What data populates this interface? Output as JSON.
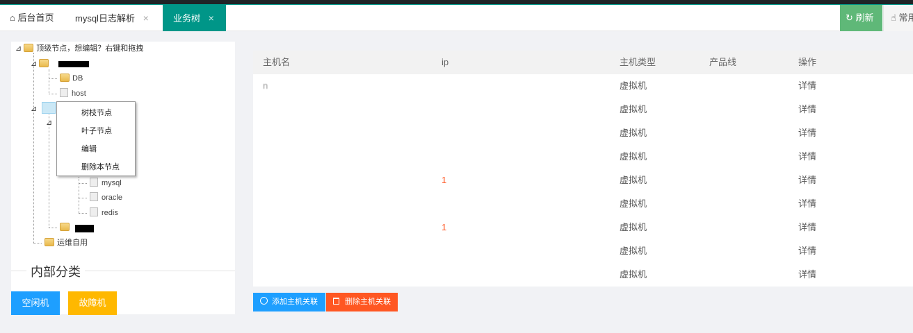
{
  "tabs": {
    "home": "后台首页",
    "mysql": "mysql日志解析",
    "business_tree": "业务树",
    "close": "×",
    "refresh": "刷新",
    "common": "常用"
  },
  "tree": {
    "root": "顶级节点，想编辑？右键和拖拽",
    "db": "DB",
    "host": "host",
    "mysql": "mysql",
    "oracle": "oracle",
    "redis": "redis",
    "ops": "运维自用"
  },
  "context_menu": {
    "branch": "树枝节点",
    "leaf": "叶子节点",
    "edit": "编辑",
    "delete": "删除本节点"
  },
  "section": {
    "title": "内部分类",
    "idle": "空闲机",
    "fault": "故障机"
  },
  "table": {
    "columns": [
      "主机名",
      "ip",
      "主机类型",
      "产品线",
      "操作"
    ],
    "rows": [
      {
        "host": "n",
        "ip": "",
        "type": "虚拟机",
        "line": "",
        "op": "详情"
      },
      {
        "host": "",
        "ip": "",
        "type": "虚拟机",
        "line": "",
        "op": "详情"
      },
      {
        "host": "",
        "ip": "",
        "type": "虚拟机",
        "line": "",
        "op": "详情"
      },
      {
        "host": "",
        "ip": "",
        "type": "虚拟机",
        "line": "",
        "op": "详情"
      },
      {
        "host": "",
        "ip": "1",
        "type": "虚拟机",
        "line": "",
        "op": "详情"
      },
      {
        "host": "",
        "ip": "",
        "type": "虚拟机",
        "line": "",
        "op": "详情"
      },
      {
        "host": "",
        "ip": "1",
        "type": "虚拟机",
        "line": "",
        "op": "详情"
      },
      {
        "host": "",
        "ip": "",
        "type": "虚拟机",
        "line": "",
        "op": "详情"
      },
      {
        "host": "",
        "ip": "",
        "type": "虚拟机",
        "line": "",
        "op": "详情"
      }
    ]
  },
  "actions": {
    "add": "添加主机关联",
    "remove": "删除主机关联"
  },
  "colors": {
    "accent": "#009688",
    "refresh": "#5fb878",
    "blue": "#1e9fff",
    "orange": "#ffb800",
    "danger": "#ff5722"
  }
}
